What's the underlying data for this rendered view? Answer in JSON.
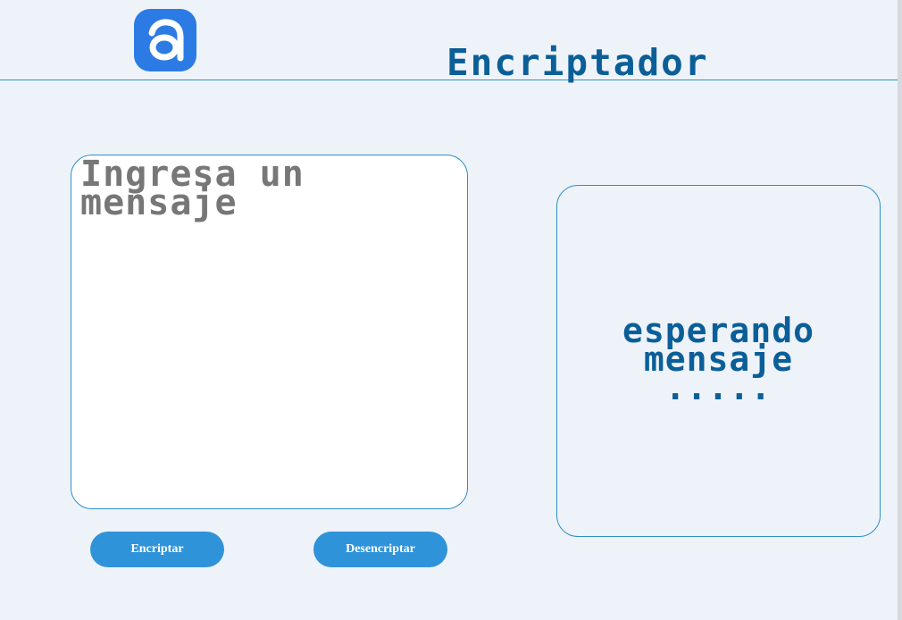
{
  "header": {
    "title": "Encriptador",
    "logo_icon": "logo-a-icon"
  },
  "input": {
    "placeholder": "Ingresa un mensaje",
    "value": ""
  },
  "output": {
    "message": "esperando\nmensaje\n....."
  },
  "buttons": {
    "encrypt_label": "Encriptar",
    "decrypt_label": "Desencriptar"
  },
  "colors": {
    "accent": "#2f93d9",
    "title": "#0b5f98",
    "logo": "#2c7be5",
    "background": "#eef3fa",
    "border": "#2f8fc7",
    "placeholder": "#777777"
  }
}
